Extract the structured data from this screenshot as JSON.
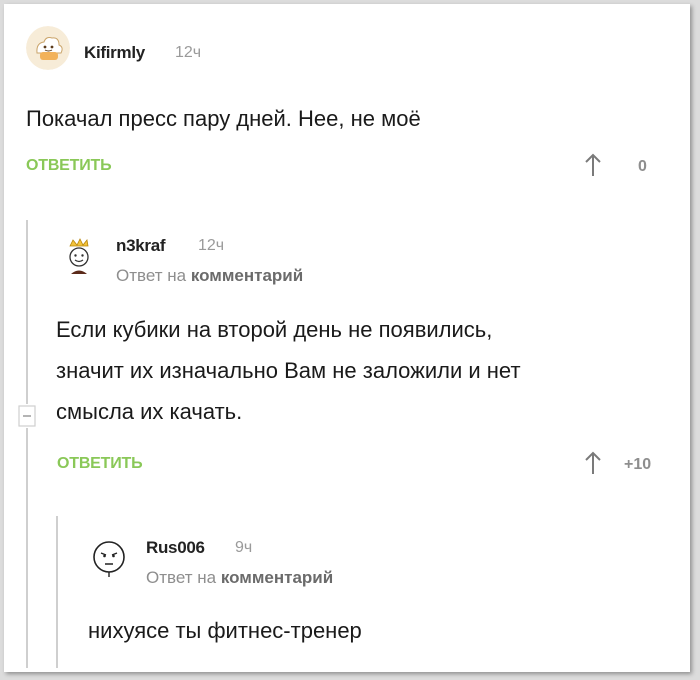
{
  "comments": [
    {
      "author": "Kifirmly",
      "time": "12ч",
      "text": "Покачал пресс пару дней. Нее, не моё",
      "reply_label": "ОТВЕТИТЬ",
      "rating": "0"
    },
    {
      "author": "n3kraf",
      "time": "12ч",
      "reply_prefix": "Ответ на",
      "reply_link": "комментарий",
      "text_lines": [
        "Если кубики на второй день не появились,",
        "значит их изначально Вам не заложили и нет",
        "смысла их качать."
      ],
      "reply_label": "ОТВЕТИТЬ",
      "rating": "+10"
    },
    {
      "author": "Rus006",
      "time": "9ч",
      "reply_prefix": "Ответ на",
      "reply_link": "комментарий",
      "text": "нихуясе ты фитнес-тренер"
    }
  ],
  "colors": {
    "reply_green": "#8ac858",
    "muted_gray": "#8e8e8e"
  },
  "icons": [
    "cloud-face-avatar-icon",
    "crown-avatar-icon",
    "troll-face-avatar-icon",
    "upvote-arrow-icon",
    "collapse-toggle-icon"
  ]
}
